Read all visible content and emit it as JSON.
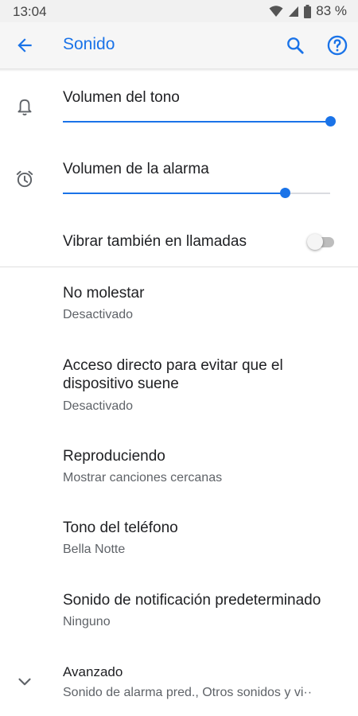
{
  "status_bar": {
    "time": "13:04",
    "battery": "83 %",
    "icons": [
      "wifi-icon",
      "cellular-signal-icon",
      "battery-icon"
    ]
  },
  "app_bar": {
    "title": "Sonido",
    "icons": [
      "back-arrow-icon",
      "search-icon",
      "help-icon"
    ],
    "accent_color": "#1a73e8"
  },
  "volume": {
    "ringer": {
      "label": "Volumen del tono",
      "icon": "bell-icon",
      "level": 1.0
    },
    "alarm": {
      "label": "Volumen de la alarma",
      "icon": "alarm-clock-icon",
      "level": 0.83
    }
  },
  "vibrate": {
    "label": "Vibrar también en llamadas",
    "enabled": false
  },
  "items": [
    {
      "title": "No molestar",
      "subtitle": "Desactivado"
    },
    {
      "title_line1": "Acceso directo para evitar que el",
      "title_line2": "dispositivo suene",
      "subtitle": "Desactivado"
    },
    {
      "title": "Reproduciendo",
      "subtitle": "Mostrar canciones cercanas"
    },
    {
      "title": "Tono del teléfono",
      "subtitle": "Bella Notte"
    },
    {
      "title": "Sonido de notificación predeterminado",
      "subtitle": "Ninguno"
    }
  ],
  "advanced": {
    "title": "Avanzado",
    "subtitle": "Sonido de alarma pred., Otros sonidos y vi··",
    "icon": "chevron-down-icon"
  }
}
